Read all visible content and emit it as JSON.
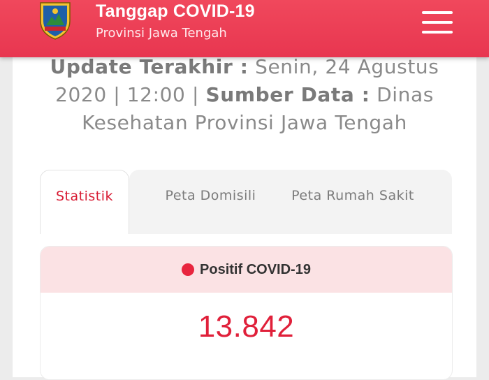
{
  "header": {
    "title": "Tanggap COVID-19",
    "subtitle": "Provinsi Jawa Tengah",
    "menu_icon": "hamburger-menu-icon",
    "logo_icon": "jawa-tengah-emblem-icon",
    "color": "#e83650"
  },
  "update": {
    "label_updated": "Update Terakhir :",
    "updated_value": "Senin, 24 Agustus 2020 | 12:00 |",
    "label_source": "Sumber Data :",
    "source_value": "Dinas Kesehatan Provinsi Jawa Tengah"
  },
  "tabs": [
    {
      "label": "Statistik",
      "active": true
    },
    {
      "label": "Peta Domisili",
      "active": false
    },
    {
      "label": "Peta Rumah Sakit",
      "active": false
    }
  ],
  "stat": {
    "label": "Positif COVID-19",
    "value": "13.842",
    "accent": "#e0203a"
  }
}
